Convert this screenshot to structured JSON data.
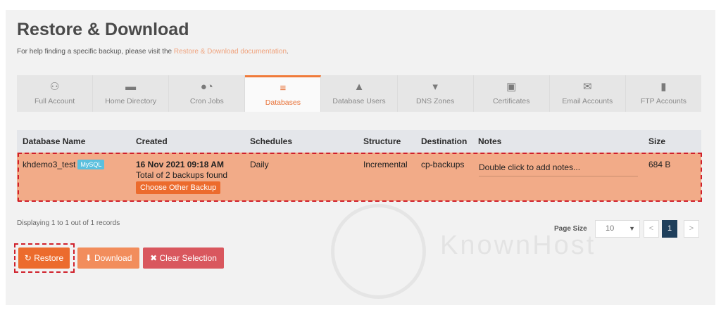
{
  "page": {
    "title": "Restore & Download",
    "help_prefix": "For help finding a specific backup, please visit the ",
    "help_link": "Restore & Download documentation",
    "help_suffix": "."
  },
  "tabs": [
    {
      "label": "Full Account",
      "icon": "sitemap-icon"
    },
    {
      "label": "Home Directory",
      "icon": "folder-icon"
    },
    {
      "label": "Cron Jobs",
      "icon": "user-clock-icon"
    },
    {
      "label": "Databases",
      "icon": "database-icon",
      "active": true
    },
    {
      "label": "Database Users",
      "icon": "user-database-icon"
    },
    {
      "label": "DNS Zones",
      "icon": "map-marker-icon"
    },
    {
      "label": "Certificates",
      "icon": "lock-icon"
    },
    {
      "label": "Email Accounts",
      "icon": "envelope-icon"
    },
    {
      "label": "FTP Accounts",
      "icon": "file-icon"
    }
  ],
  "table": {
    "columns": [
      "Database Name",
      "Created",
      "Schedules",
      "Structure",
      "Destination",
      "Notes",
      "Size"
    ],
    "row": {
      "name": "khdemo3_test",
      "badge": "MySQL",
      "created_date": "16 Nov 2021 09:18 AM",
      "created_sub": "Total of 2 backups found",
      "choose_label": "Choose Other Backup",
      "schedule": "Daily",
      "structure": "Incremental",
      "destination": "cp-backups",
      "notes_placeholder": "Double click to add notes...",
      "size": "684 B"
    }
  },
  "footer": {
    "records": "Displaying 1 to 1 out of 1 records",
    "page_size_label": "Page Size",
    "page_size_value": "10",
    "prev": "<",
    "current_page": "1",
    "next": ">"
  },
  "actions": {
    "restore": "Restore",
    "download": "Download",
    "clear": "Clear Selection"
  },
  "watermark": "KnownHost",
  "colors": {
    "accent": "#ec6b2d",
    "selected_row": "#f2ab88",
    "highlight_outline": "#d0202b",
    "badge": "#5bc0de",
    "clear_button": "#d9575e"
  }
}
